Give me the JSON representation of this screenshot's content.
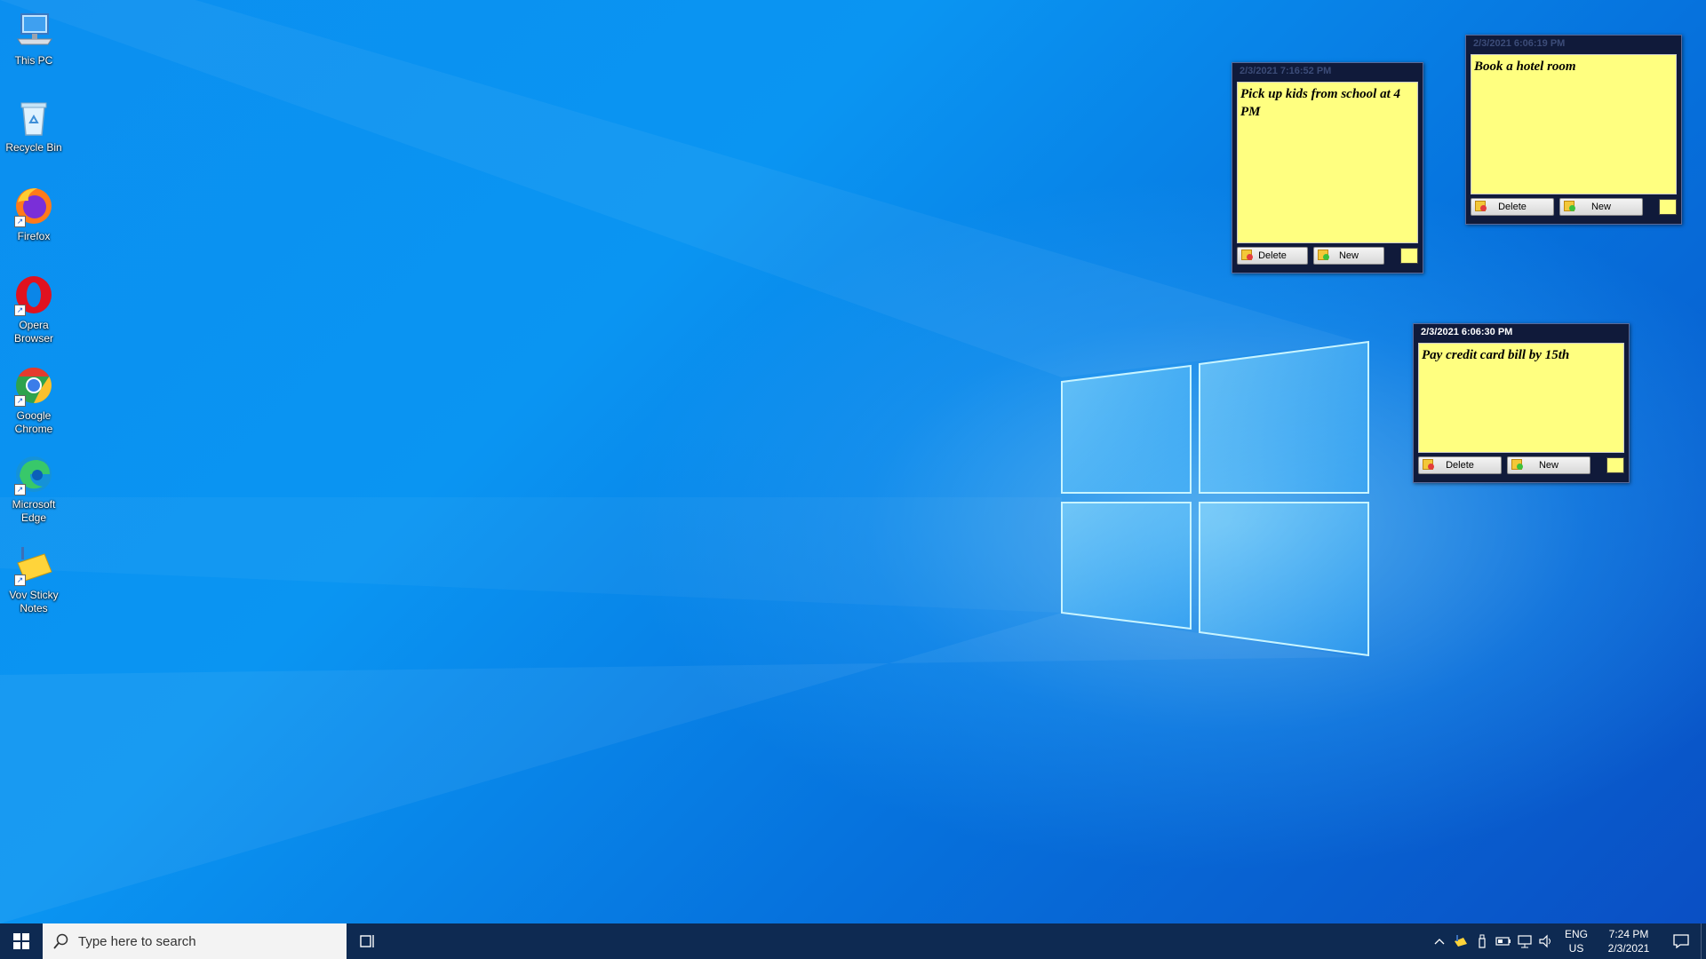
{
  "desktop": {
    "icons": [
      {
        "label": "This PC",
        "icon": "computer-icon"
      },
      {
        "label": "Recycle Bin",
        "icon": "recycle-bin-icon"
      },
      {
        "label": "Firefox",
        "icon": "firefox-icon"
      },
      {
        "label": "Opera Browser",
        "icon": "opera-icon"
      },
      {
        "label": "Google Chrome",
        "icon": "chrome-icon"
      },
      {
        "label": "Microsoft Edge",
        "icon": "edge-icon"
      },
      {
        "label": "Vov Sticky Notes",
        "icon": "sticky-notes-icon"
      }
    ]
  },
  "notes": [
    {
      "timestamp": "2/3/2021 7:16:52 PM",
      "text": "Pick up kids from school at 4 PM",
      "delete_label": "Delete",
      "new_label": "New",
      "active": false,
      "color": "#ffff80"
    },
    {
      "timestamp": "2/3/2021 6:06:19 PM",
      "text": "Book a hotel room",
      "delete_label": "Delete",
      "new_label": "New",
      "active": false,
      "color": "#ffff80"
    },
    {
      "timestamp": "2/3/2021 6:06:30 PM",
      "text": "Pay credit card bill by 15th",
      "delete_label": "Delete",
      "new_label": "New",
      "active": true,
      "color": "#ffff80"
    }
  ],
  "taskbar": {
    "search_placeholder": "Type here to search",
    "language": "ENG",
    "region": "US",
    "time": "7:24 PM",
    "date": "2/3/2021",
    "tray_icons": [
      "chevron-up-icon",
      "sticky-notes-tray-icon",
      "usb-icon",
      "battery-icon",
      "network-icon",
      "volume-icon"
    ]
  },
  "colors": {
    "note_yellow": "#ffff80",
    "note_frame": "#101a3a",
    "taskbar": "#0e2a52"
  }
}
